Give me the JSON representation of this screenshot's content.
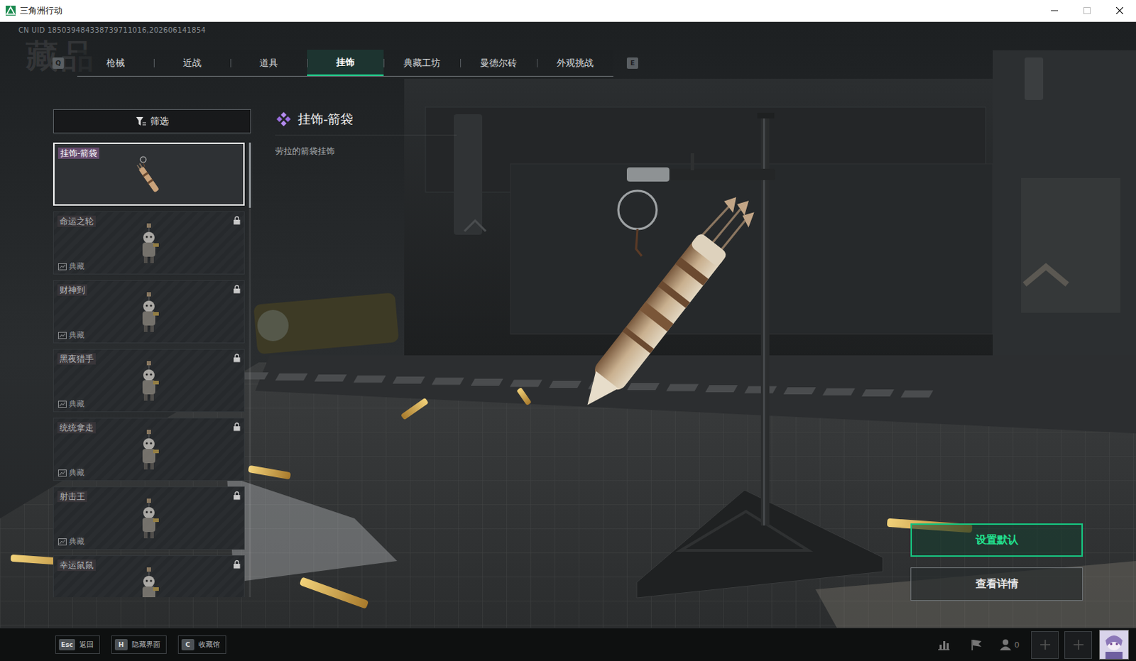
{
  "window": {
    "title": "三角洲行动"
  },
  "uid": "CN UID 185039484338739711016,202606141854",
  "watermark": "藏品",
  "tab_keys": {
    "prev": "Q",
    "next": "E"
  },
  "tabs": [
    {
      "label": "枪械",
      "selected": false
    },
    {
      "label": "近战",
      "selected": false
    },
    {
      "label": "道具",
      "selected": false
    },
    {
      "label": "挂饰",
      "selected": true
    },
    {
      "label": "典藏工坊",
      "selected": false
    },
    {
      "label": "曼德尔砖",
      "selected": false
    },
    {
      "label": "外观挑战",
      "selected": false
    }
  ],
  "filter": {
    "label": "筛选"
  },
  "items": [
    {
      "name": "挂饰-箭袋",
      "kind": "quiver",
      "locked": false,
      "selected": true
    },
    {
      "name": "命运之轮",
      "kind": "figure",
      "tag": "典藏",
      "locked": true,
      "selected": false
    },
    {
      "name": "财神到",
      "kind": "figure",
      "tag": "典藏",
      "locked": true,
      "selected": false
    },
    {
      "name": "黑夜猎手",
      "kind": "figure",
      "tag": "典藏",
      "locked": true,
      "selected": false
    },
    {
      "name": "统统拿走",
      "kind": "figure",
      "tag": "典藏",
      "locked": true,
      "selected": false
    },
    {
      "name": "射击王",
      "kind": "figure",
      "tag": "典藏",
      "locked": true,
      "selected": false
    },
    {
      "name": "幸运鼠鼠",
      "kind": "figure",
      "locked": true,
      "selected": false
    }
  ],
  "detail": {
    "title": "挂饰-箭袋",
    "description": "劳拉的箭袋挂饰"
  },
  "actions": [
    {
      "label": "设置默认",
      "primary": true
    },
    {
      "label": "查看详情",
      "primary": false
    }
  ],
  "hints": [
    {
      "key": "Esc",
      "label": "返回"
    },
    {
      "key": "H",
      "label": "隐藏界面"
    },
    {
      "key": "C",
      "label": "收藏馆"
    }
  ],
  "status": {
    "friends_count": "0"
  }
}
